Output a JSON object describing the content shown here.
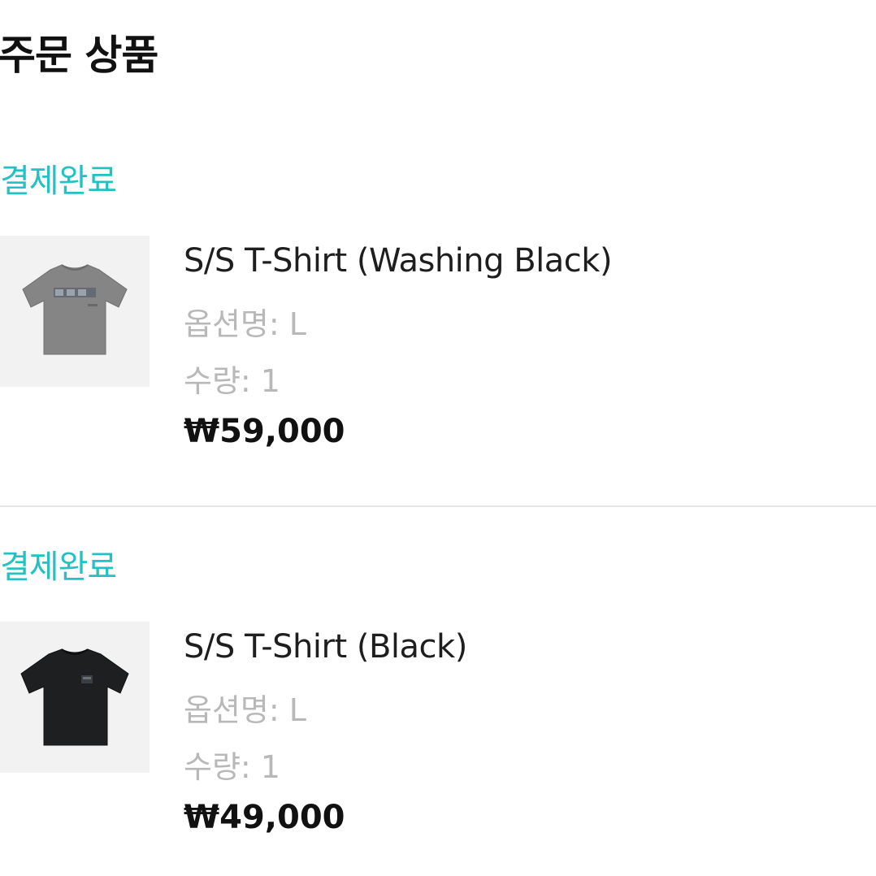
{
  "header": {
    "title": "주문 상품"
  },
  "orders": [
    {
      "status": "결제완료",
      "product_name": "S/S T-Shirt (Washing Black)",
      "option": "옵션명: L",
      "quantity": "수량: 1",
      "price": "₩59,000",
      "thumbnail_icon": "gray-tshirt-image"
    },
    {
      "status": "결제완료",
      "product_name": "S/S T-Shirt (Black)",
      "option": "옵션명: L",
      "quantity": "수량: 1",
      "price": "₩49,000",
      "thumbnail_icon": "black-tshirt-image"
    }
  ],
  "colors": {
    "status": "#22c1c3",
    "muted_text": "#b8b8b8",
    "primary_text": "#111111",
    "thumbnail_bg": "#f2f2f2",
    "shirt_gray": "#858585",
    "shirt_black": "#1e1f21"
  }
}
